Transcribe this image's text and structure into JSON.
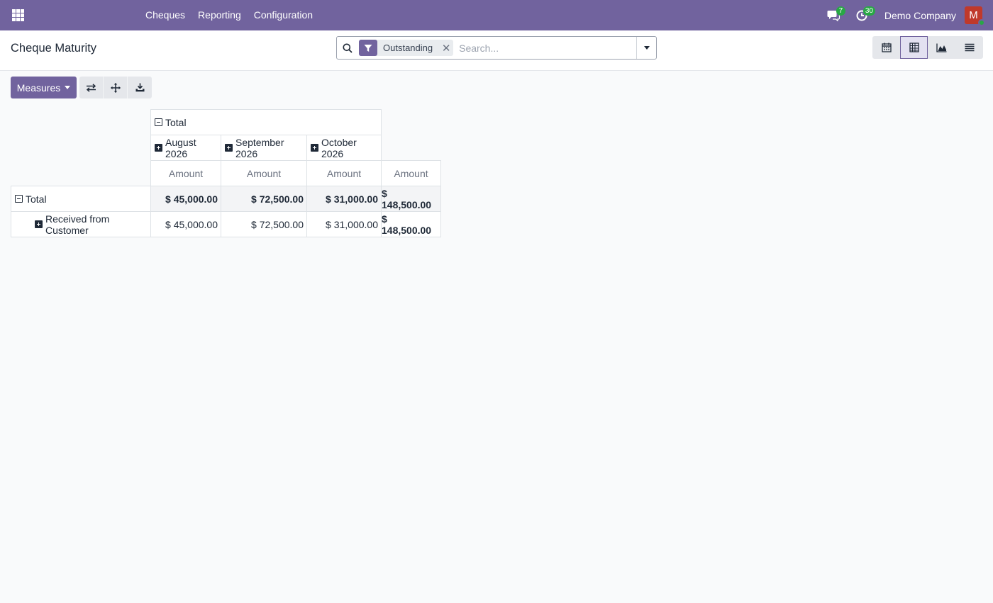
{
  "navbar": {
    "menu": [
      "Cheques",
      "Reporting",
      "Configuration"
    ],
    "messages_count": "7",
    "activities_count": "30",
    "company": "Demo Company",
    "avatar_letter": "M"
  },
  "control_panel": {
    "title": "Cheque Maturity",
    "search": {
      "facet_value": "Outstanding",
      "placeholder": "Search..."
    },
    "views": [
      "calendar-icon",
      "pivot-icon",
      "graph-icon",
      "list-icon"
    ],
    "active_view": "pivot"
  },
  "pivot": {
    "measures_label": "Measures",
    "column_group_label": "Total",
    "columns": [
      "August 2026",
      "September 2026",
      "October 2026"
    ],
    "measure_label": "Amount",
    "rows": [
      {
        "label": "Total",
        "values": [
          "$ 45,000.00",
          "$ 72,500.00",
          "$ 31,000.00"
        ],
        "total": "$ 148,500.00"
      },
      {
        "label": "Received from Customer",
        "values": [
          "$ 45,000.00",
          "$ 72,500.00",
          "$ 31,000.00"
        ],
        "total": "$ 148,500.00"
      }
    ]
  },
  "colors": {
    "navbar": "#71639e",
    "primary": "#71639e",
    "badge": "#28a745",
    "avatar": "#c0392b"
  }
}
